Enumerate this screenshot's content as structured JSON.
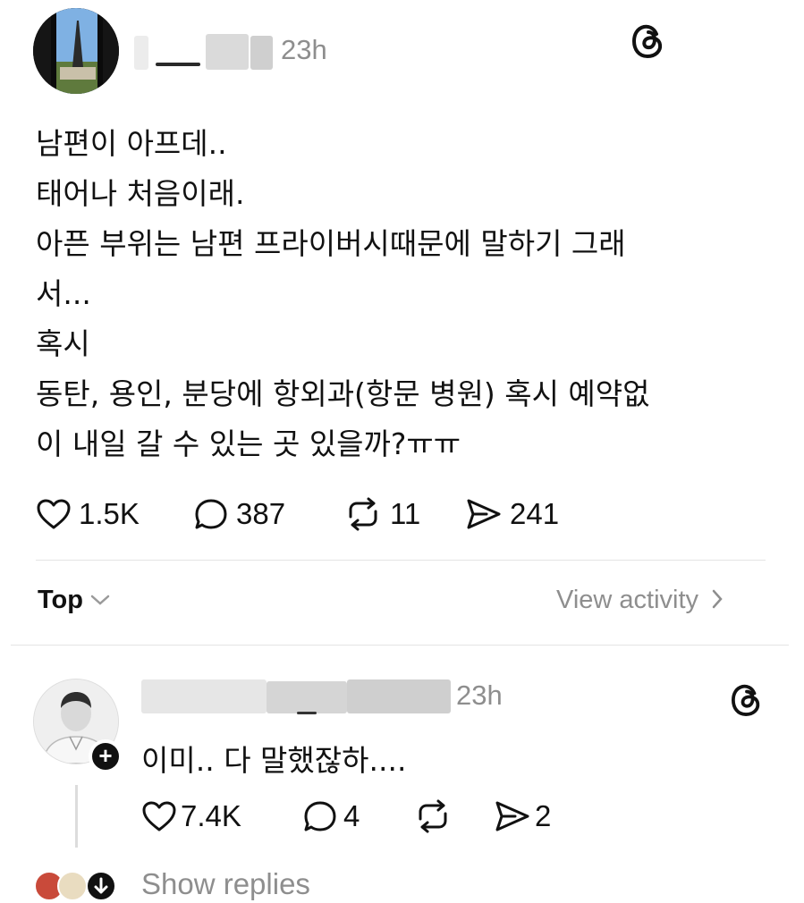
{
  "post": {
    "time": "23h",
    "threads_logo_icon": "threads-logo-icon",
    "body_lines": [
      "남편이 아프데..",
      "태어나 처음이래.",
      "아픈 부위는 남편 프라이버시때문에 말하기 그래",
      "서...",
      "혹시",
      "동탄, 용인, 분당에 항외과(항문 병원) 혹시 예약없",
      "이 내일 갈 수 있는 곳 있을까?ㅠㅠ"
    ],
    "stats": {
      "likes": "1.5K",
      "comments": "387",
      "reposts": "11",
      "shares": "241"
    }
  },
  "sort": {
    "label": "Top",
    "view_activity": "View activity"
  },
  "reply": {
    "time": "23h",
    "text": "이미.. 다 말했잖하....",
    "follow_badge": "+",
    "stats": {
      "likes": "7.4K",
      "comments": "4",
      "shares": "2"
    }
  },
  "show_replies": "Show replies"
}
